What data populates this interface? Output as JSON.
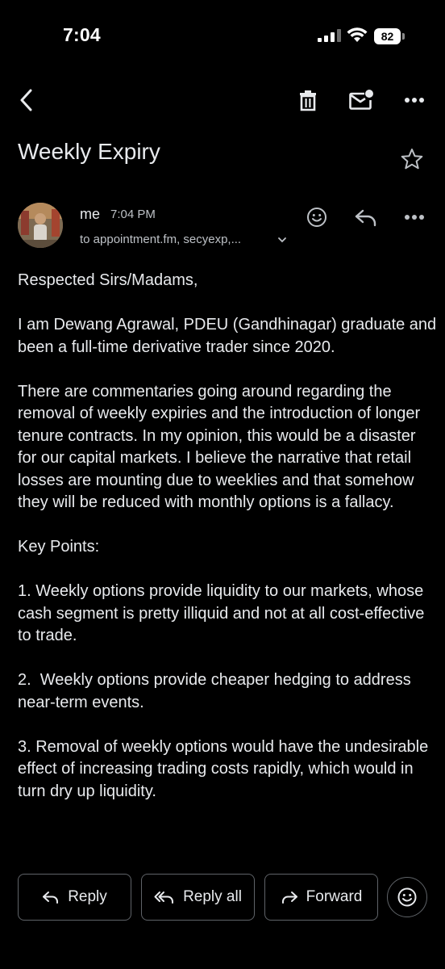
{
  "status_bar": {
    "time": "7:04",
    "battery": "82"
  },
  "toolbar": {
    "back_icon": "chevron-left-icon",
    "delete_icon": "trash-icon",
    "mark_unread_icon": "mail-unread-icon",
    "more_icon": "more-horizontal-icon"
  },
  "subject": "Weekly Expiry",
  "sender": {
    "name": "me",
    "time": "7:04 PM",
    "recipients": "to appointment.fm, secyexp,..."
  },
  "body": {
    "paragraphs": [
      "Respected Sirs/Madams,",
      "I am Dewang Agrawal, PDEU (Gandhinagar) graduate and been a full-time derivative trader since 2020.",
      "There are commentaries going around regarding the removal of weekly expiries and the introduction of longer tenure contracts. In my opinion, this would be a disaster for our capital markets. I believe the narrative that retail losses are mounting due to weeklies and that somehow they will be reduced with monthly options is a fallacy.",
      "Key Points:",
      "1. Weekly options provide liquidity to our markets, whose cash segment is pretty illiquid and not at all cost-effective to trade.",
      "2.  Weekly options provide cheaper hedging to address near-term events.",
      "3. Removal of weekly options would have the undesirable effect of increasing trading costs rapidly, which would in turn dry up liquidity."
    ]
  },
  "actions": {
    "reply": "Reply",
    "reply_all": "Reply all",
    "forward": "Forward"
  }
}
